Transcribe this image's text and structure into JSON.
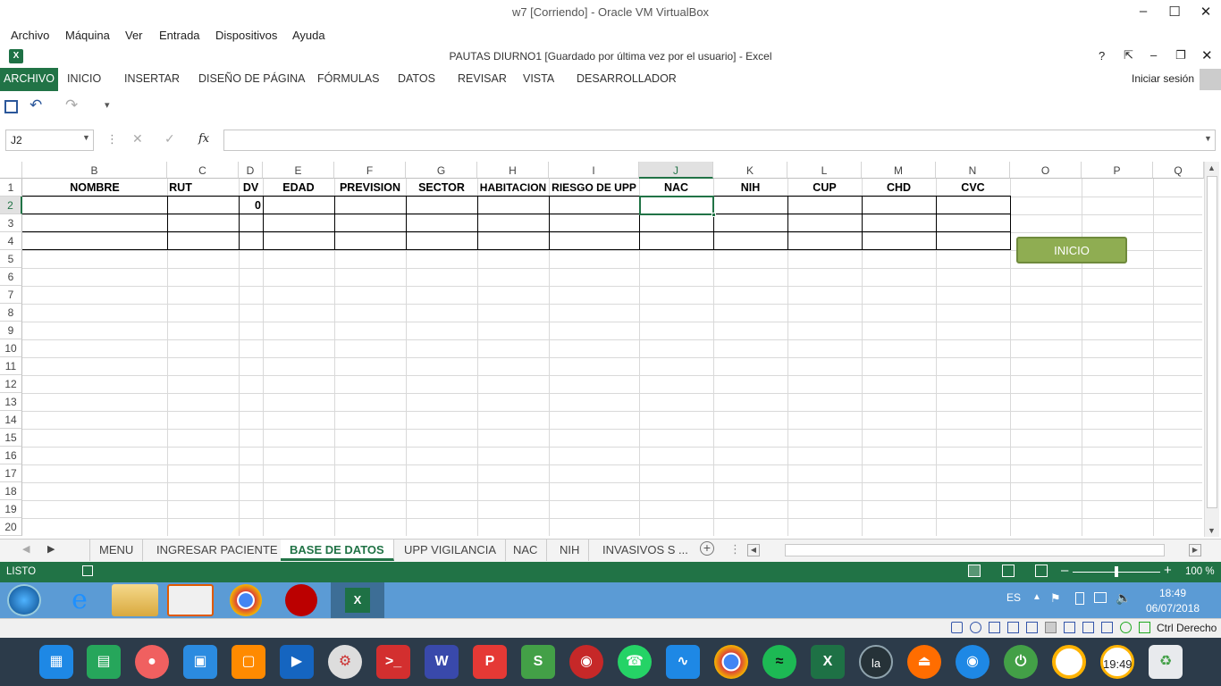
{
  "vbox": {
    "title": "w7 [Corriendo] - Oracle VM VirtualBox",
    "menu": [
      "Archivo",
      "Máquina",
      "Ver",
      "Entrada",
      "Dispositivos",
      "Ayuda"
    ],
    "host_key": "Ctrl Derecho"
  },
  "excel": {
    "title": "PAUTAS DIURNO1 [Guardado por última vez por el usuario] - Excel",
    "help": "?",
    "signin": "Iniciar sesión",
    "tabs": [
      "ARCHIVO",
      "INICIO",
      "INSERTAR",
      "DISEÑO DE PÁGINA",
      "FÓRMULAS",
      "DATOS",
      "REVISAR",
      "VISTA",
      "DESARROLLADOR"
    ],
    "namebox": "J2",
    "fx": "fx",
    "columns": [
      "B",
      "C",
      "D",
      "E",
      "F",
      "G",
      "H",
      "I",
      "J",
      "K",
      "L",
      "M",
      "N",
      "O",
      "P",
      "Q"
    ],
    "rows": [
      "1",
      "2",
      "3",
      "4",
      "5",
      "6",
      "7",
      "8",
      "9",
      "10",
      "11",
      "12",
      "13",
      "14",
      "15",
      "16",
      "17",
      "18",
      "19",
      "20"
    ],
    "headers": [
      "NOMBRE",
      "RUT",
      "DV",
      "EDAD",
      "PREVISION",
      "SECTOR",
      "HABITACION",
      "RIESGO DE UPP",
      "NAC",
      "NIH",
      "CUP",
      "CHD",
      "CVC"
    ],
    "d2": "0",
    "button": "INICIO",
    "sheets": [
      "MENU",
      "INGRESAR PACIENTE",
      "BASE DE DATOS",
      "UPP VIGILANCIA",
      "NAC",
      "NIH",
      "INVASIVOS S ..."
    ],
    "active_sheet": "BASE DE DATOS",
    "status": "LISTO",
    "zoom": "100 %",
    "zoom_level": 0.5
  },
  "taskbar": {
    "lang": "ES",
    "time": "18:49",
    "date": "06/07/2018"
  },
  "dock": {
    "clock": "19:49"
  }
}
